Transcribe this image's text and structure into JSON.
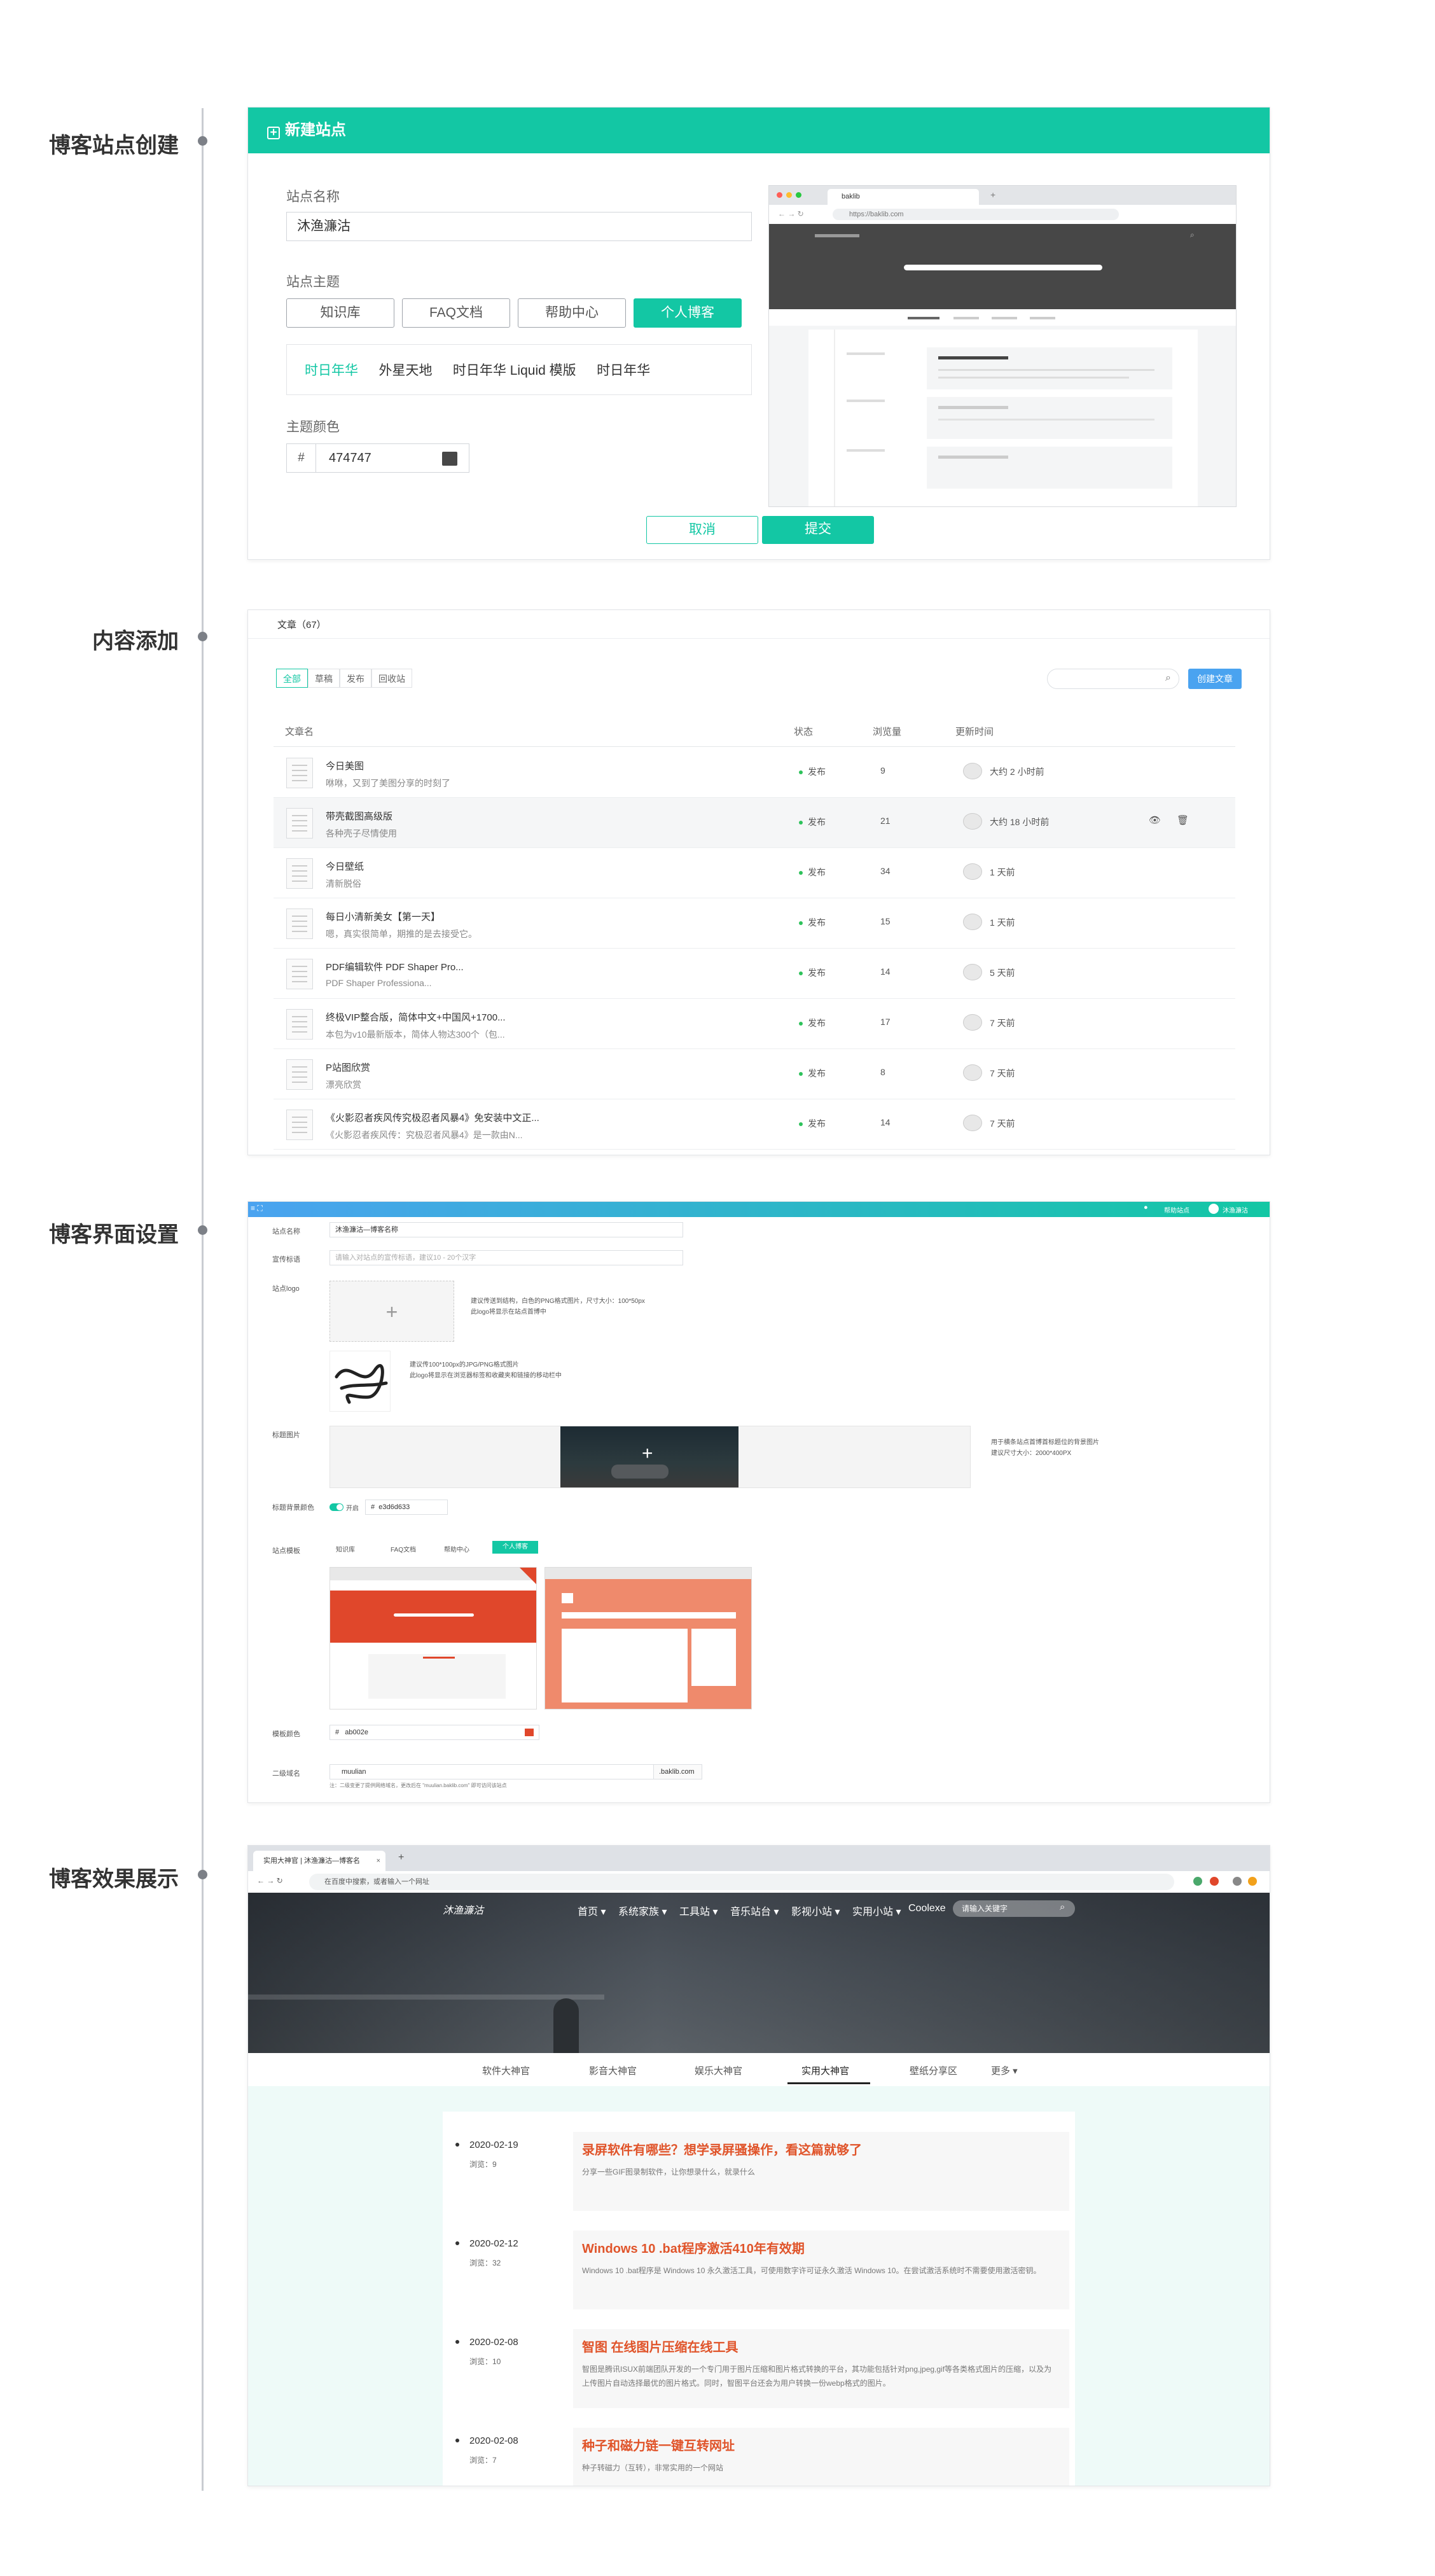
{
  "labels": {
    "s1": "博客站点创建",
    "s2": "内容添加",
    "s3": "博客界面设置",
    "s4": "博客效果展示"
  },
  "new_site": {
    "title": "新建站点",
    "name_label": "站点名称",
    "name_value": "沐渔濂沽",
    "theme_label": "站点主题",
    "themes": [
      "知识库",
      "FAQ文档",
      "帮助中心",
      "个人博客"
    ],
    "subthemes": [
      "时日年华",
      "外星天地",
      "时日年华 Liquid 模版",
      "时日年华"
    ],
    "color_label": "主题颜色",
    "color_prefix": "#",
    "color_value": "474747",
    "color_hex": "#474747",
    "cancel": "取消",
    "submit": "提交",
    "preview_tab": "baklib",
    "preview_url": "https://baklib.com"
  },
  "articles": {
    "title": "文章（67）",
    "filters": [
      "全部",
      "草稿",
      "发布",
      "回收站"
    ],
    "create_button": "创建文章",
    "columns": [
      "文章名",
      "状态",
      "浏览量",
      "更新时间"
    ],
    "rows": [
      {
        "title": "今日美图",
        "subtitle": "咻咻，又到了美图分享的时刻了",
        "status": "发布",
        "views": "9",
        "time": "大约 2 小时前"
      },
      {
        "title": "带壳截图高级版",
        "subtitle": "各种壳子尽情使用",
        "status": "发布",
        "views": "21",
        "time": "大约 18 小时前"
      },
      {
        "title": "今日壁纸",
        "subtitle": "清新脱俗",
        "status": "发布",
        "views": "34",
        "time": "1 天前"
      },
      {
        "title": "每日小清新美女【第一天】",
        "subtitle": "嗯，真实很简单，期推的是去接受它。",
        "status": "发布",
        "views": "15",
        "time": "1 天前"
      },
      {
        "title": "PDF编辑软件 PDF Shaper Pro...",
        "subtitle": "PDF Shaper Professiona...",
        "status": "发布",
        "views": "14",
        "time": "5 天前"
      },
      {
        "title": "终极VIP整合版，简体中文+中国风+1700...",
        "subtitle": "本包为v10最新版本，简体人物达300个（包...",
        "status": "发布",
        "views": "17",
        "time": "7 天前"
      },
      {
        "title": "P站图欣赏",
        "subtitle": "漂亮欣赏",
        "status": "发布",
        "views": "8",
        "time": "7 天前"
      },
      {
        "title": "《火影忍者疾风传究极忍者风暴4》免安装中文正...",
        "subtitle": "《火影忍者疾风传：究极忍者风暴4》是一款由N...",
        "status": "发布",
        "views": "14",
        "time": "7 天前"
      }
    ]
  },
  "settings": {
    "top_right": [
      "帮助站点",
      "沐渔濂沽"
    ],
    "name_label": "站点名称",
    "name_value": "沐渔濂沽—博客名称",
    "desc_label": "宣传标语",
    "desc_placeholder": "请输入对站点的宣传标语，建议10 - 20个汉字",
    "logo_label": "站点logo",
    "logo_tips": [
      "建议传送到结构，白色的PNG格式图片，尺寸大小：100*50px",
      "此logo将显示在站点首博中"
    ],
    "logo2_tips": [
      "建议传100*100px的JPG/PNG格式图片",
      "此logo将显示在浏览器标签和收藏夹和链接的移动栏中"
    ],
    "banner_label": "标题图片",
    "banner_tips": [
      "用于横条站点首博首标题位的背景图片",
      "建议尺寸大小：2000*400PX"
    ],
    "overlay_label": "标题背景颜色",
    "overlay_toggle": "开启",
    "overlay_prefix": "#",
    "overlay_value": "e3d6d633",
    "theme_label": "站点模板",
    "themes": [
      "知识库",
      "FAQ文档",
      "帮助中心",
      "个人博客"
    ],
    "color_label": "模板颜色",
    "color_prefix": "#",
    "color_value": "ab002e",
    "color_hex": "#e0472b",
    "domain_label": "二级域名",
    "domain_value": "muulian",
    "domain_suffix": ".baklib.com",
    "domain_note": "注：二级变更了提供网络域名，更改后在 \"muulian.baklib.com\" 即可访问该站点"
  },
  "blog": {
    "browser_tab": "实用大神官 | 沐渔濂沽—博客名",
    "browser_url": "在百度中搜索，或者输入一个网址",
    "logo_text": "沐渔濂沽",
    "nav": [
      "首页 ▾",
      "系统家族 ▾",
      "工具站 ▾",
      "音乐站台 ▾",
      "影视小站 ▾",
      "实用小站 ▾",
      "Coolexe"
    ],
    "search_placeholder": "请输入关键字",
    "tabs": [
      "软件大神官",
      "影音大神官",
      "娱乐大神官",
      "实用大神官",
      "壁纸分享区",
      "更多 ▾"
    ],
    "active_tab_index": 3,
    "posts": [
      {
        "date": "2020-02-19",
        "views": "浏览：9",
        "title": "录屏软件有哪些？想学录屏骚操作，看这篇就够了",
        "desc": "分享一些GIF图录制软件，让你想录什么，就录什么"
      },
      {
        "date": "2020-02-12",
        "views": "浏览：32",
        "title": "Windows 10 .bat程序激活410年有效期",
        "desc": "Windows 10 .bat程序是 Windows 10 永久激活工具，可使用数字许可证永久激活 Windows 10。在尝试激活系统时不需要使用激活密钥。"
      },
      {
        "date": "2020-02-08",
        "views": "浏览：10",
        "title": "智图 在线图片压缩在线工具",
        "desc": "智图是腾讯ISUX前端团队开发的一个专门用于图片压缩和图片格式转换的平台，其功能包括针对png,jpeg,gif等各类格式图片的压缩，以及为上传图片自动选择最优的图片格式。同时，智图平台还会为用户转换一份webp格式的图片。"
      },
      {
        "date": "2020-02-08",
        "views": "浏览：7",
        "title": "种子和磁力链一键互转网址",
        "desc": "种子转磁力（互转），非常实用的一个网站"
      }
    ]
  },
  "icons": {
    "plus": "plus-icon",
    "search": "search-icon",
    "eye": "eye-icon",
    "trash": "trash-icon",
    "bell": "bell-icon"
  },
  "colors": {
    "accent": "#13c7a4",
    "blue_button": "#4aa3f0",
    "blog_accent": "#e0542a"
  }
}
